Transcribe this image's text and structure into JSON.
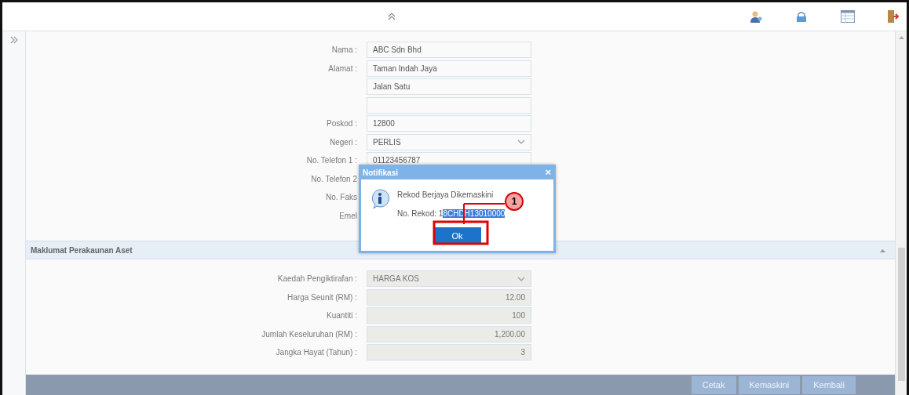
{
  "form": {
    "fields": [
      {
        "label": "Nama :",
        "value": "ABC Sdn Bhd",
        "kind": "text"
      },
      {
        "label": "Alamat :",
        "value": "Taman Indah Jaya",
        "kind": "text"
      },
      {
        "value": "Jalan Satu",
        "kind": "text"
      },
      {
        "kind": "text"
      },
      {
        "label": "Poskod :",
        "value": "12800",
        "kind": "text"
      },
      {
        "label": "Negeri :",
        "value": "PERLIS",
        "kind": "select"
      },
      {
        "label": "No. Telefon 1 :",
        "value": "01123456787",
        "kind": "text"
      },
      {
        "label": "No. Telefon 2",
        "kind": "hidden"
      },
      {
        "label": "No. Faks",
        "kind": "hidden"
      },
      {
        "label": "Emel",
        "kind": "hidden"
      }
    ]
  },
  "section": {
    "title": "Maklumat Perakaunan Aset",
    "expanded": true,
    "fields": [
      {
        "label": "Kaedah Pengiktirafan :",
        "value": "HARGA KOS",
        "kind": "select",
        "disabled": true
      },
      {
        "label": "Harga Seunit (RM) :",
        "value": "12.00",
        "kind": "number",
        "disabled": true
      },
      {
        "label": "Kuantiti :",
        "value": "100",
        "kind": "number",
        "disabled": true
      },
      {
        "label": "Jumlah Keseluruhan (RM) :",
        "value": "1,200.00",
        "kind": "number",
        "disabled": true
      },
      {
        "label": "Jangka Hayat (Tahun) :",
        "value": "3",
        "kind": "number",
        "disabled": true
      }
    ]
  },
  "footer_buttons": [
    "Cetak",
    "Kemaskini",
    "Kembali"
  ],
  "dialog": {
    "title": "Notifikasi",
    "close": "×",
    "message": "Rekod Berjaya Dikemaskini",
    "record_label": "No. Rekod: 1",
    "record_selected": "8CHDH13010000",
    "button": "Ok"
  },
  "callout": {
    "number": "1"
  }
}
